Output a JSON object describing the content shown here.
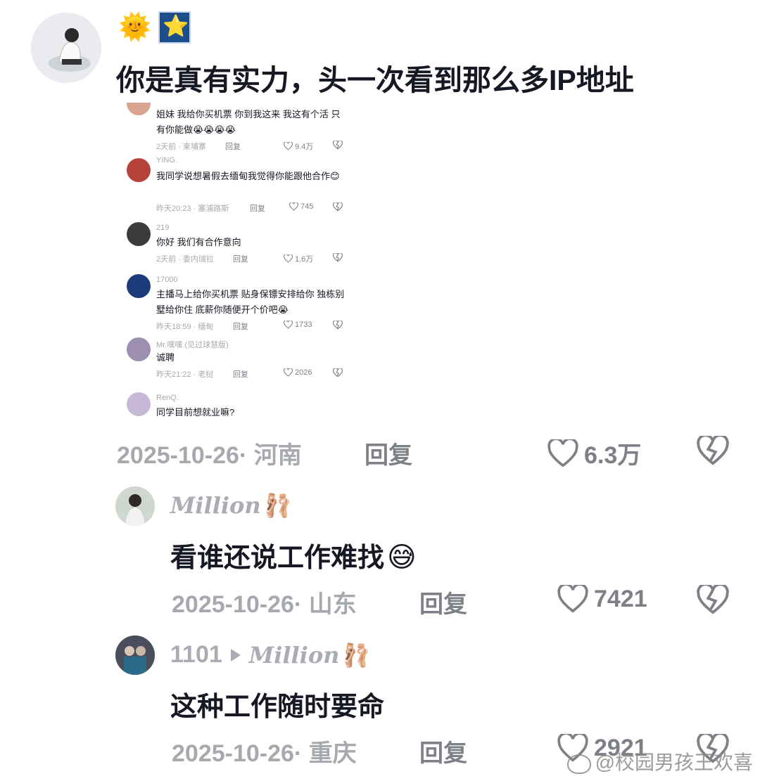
{
  "main_comment": {
    "emoji_1": "🌞",
    "emoji_2": "⭐",
    "text": "你是真有实力，头一次看到那么多IP地址",
    "date": "2025-10-26",
    "location": "河南",
    "reply_label": "回复",
    "likes": "6.3万"
  },
  "embedded": [
    {
      "user": "",
      "text": "姐妹  我给你买机票  你到我这来  我这有个活  只有你能做😭😭😭😭",
      "time": "2天前",
      "location": "柬埔寨",
      "reply_label": "回复",
      "likes": "9.4万"
    },
    {
      "user": "YING.",
      "text": "我同学说想暑假去缅甸我觉得你能跟他合作😊",
      "time": "昨天20:23",
      "location": "塞浦路斯",
      "reply_label": "回复",
      "likes": "745"
    },
    {
      "user": "219",
      "text": "你好  我们有合作意向",
      "time": "2天前",
      "location": "委内瑞拉",
      "reply_label": "回复",
      "likes": "1.6万"
    },
    {
      "user": "17000",
      "text": "主播马上给你买机票 贴身保镖安排给你  独栋别墅给你住 底薪你随便开个价吧😭",
      "time": "昨天18:59",
      "location": "缅甸",
      "reply_label": "回复",
      "likes": "1733"
    },
    {
      "user": "Mr.嘿嘿 (见过球慧版)",
      "text": "诚聘",
      "time": "昨天21:22",
      "location": "老挝",
      "reply_label": "回复",
      "likes": "2026"
    },
    {
      "user": "RenQ.",
      "text": "同学目前想就业嘛?",
      "time": "",
      "location": "",
      "reply_label": "",
      "likes": ""
    }
  ],
  "replies": [
    {
      "name": "Million",
      "name_emoji": "🩰",
      "text": "看谁还说工作难找",
      "text_emoji": "😅",
      "date": "2025-10-26",
      "location": "山东",
      "reply_label": "回复",
      "likes": "7421"
    },
    {
      "user_id": "1101",
      "reply_to": "Million",
      "reply_to_emoji": "🩰",
      "text": "这种工作随时要命",
      "date": "2025-10-26",
      "location": "重庆",
      "reply_label": "回复",
      "likes": "2921"
    }
  ],
  "watermark": "@校园男孩王欢喜",
  "colors": {
    "text": "#161823",
    "muted": "#a6a9ae",
    "action": "#7d8087"
  }
}
